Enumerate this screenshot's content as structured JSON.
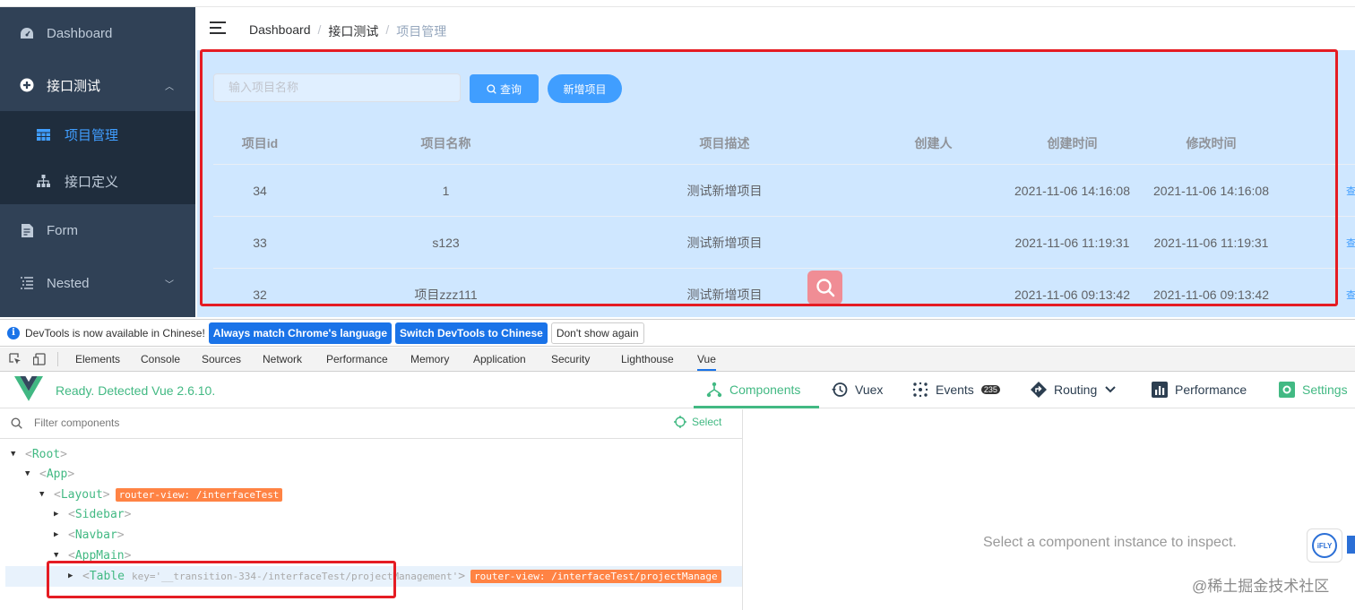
{
  "sidebar": {
    "items": [
      {
        "label": "Dashboard",
        "icon": "dashboard-icon"
      },
      {
        "label": "接口测试",
        "icon": "plus-circle-icon",
        "expanded": true
      },
      {
        "label": "项目管理",
        "icon": "table-icon",
        "active": true
      },
      {
        "label": "接口定义",
        "icon": "tree-icon"
      },
      {
        "label": "Form",
        "icon": "form-icon"
      },
      {
        "label": "Nested",
        "icon": "nested-list-icon"
      }
    ]
  },
  "breadcrumb": [
    "Dashboard",
    "接口测试",
    "项目管理"
  ],
  "toolbar": {
    "search_placeholder": "输入项目名称",
    "query_label": "查询",
    "add_label": "新增项目"
  },
  "table": {
    "headers": [
      "项目id",
      "项目名称",
      "项目描述",
      "创建人",
      "创建时间",
      "修改时间"
    ],
    "rows": [
      {
        "id": "34",
        "name": "1",
        "desc": "测试新增项目",
        "creator": "",
        "created": "2021-11-06 14:16:08",
        "modified": "2021-11-06 14:16:08",
        "op": "查"
      },
      {
        "id": "33",
        "name": "s123",
        "desc": "测试新增项目",
        "creator": "",
        "created": "2021-11-06 11:19:31",
        "modified": "2021-11-06 11:19:31",
        "op": "查"
      },
      {
        "id": "32",
        "name": "项目zzz111",
        "desc": "测试新增项目",
        "creator": "",
        "created": "2021-11-06 09:13:42",
        "modified": "2021-11-06 09:13:42",
        "op": "查"
      }
    ]
  },
  "devtools_banner": {
    "message": "DevTools is now available in Chinese!",
    "btn_match": "Always match Chrome's language",
    "btn_switch": "Switch DevTools to Chinese",
    "btn_dismiss": "Don't show again"
  },
  "devtools_tabs": [
    "Elements",
    "Console",
    "Sources",
    "Network",
    "Performance",
    "Memory",
    "Application",
    "Security",
    "Lighthouse",
    "Vue"
  ],
  "vue": {
    "ready": "Ready. Detected Vue 2.6.10.",
    "tabs": {
      "components": "Components",
      "vuex": "Vuex",
      "events": "Events",
      "events_count": "235",
      "routing": "Routing",
      "performance": "Performance",
      "settings": "Settings"
    },
    "filter_placeholder": "Filter components",
    "select_label": "Select",
    "inspect_msg": "Select a component instance to inspect.",
    "tree": {
      "root": "Root",
      "app": "App",
      "layout": "Layout",
      "layout_badge": "router-view: /interfaceTest",
      "sidebar": "Sidebar",
      "navbar": "Navbar",
      "appmain": "AppMain",
      "table": "Table",
      "table_key": "key='__transition-334-/interfaceTest/projectManagement'",
      "table_badge": "router-view: /interfaceTest/projectManage"
    }
  },
  "watermark": "@稀土掘金技术社区",
  "fly_label": "iFLY",
  "colors": {
    "accent": "#409eff",
    "vue_green": "#42b983",
    "sidebar_bg": "#304156",
    "highlight_red": "#e51c23"
  }
}
